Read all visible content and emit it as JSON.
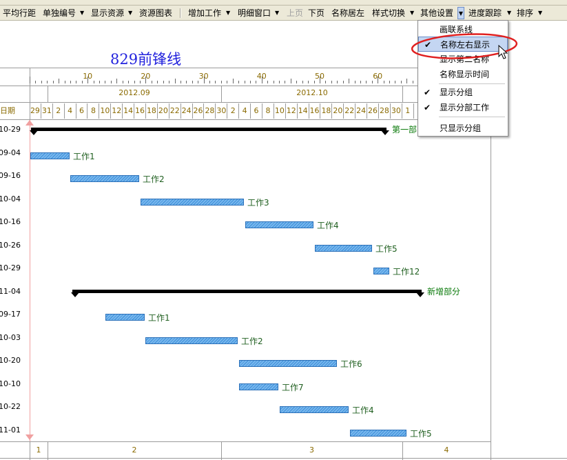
{
  "toolbar": {
    "items": [
      "平均行距",
      "单独编号",
      "显示资源",
      "资源图表",
      "增加工作",
      "明细窗口",
      "上页",
      "下页",
      "名称居左",
      "样式切换",
      "其他设置",
      "进度跟踪",
      "排序"
    ]
  },
  "dropdown": {
    "items": [
      {
        "label": "画联系线",
        "checked": false,
        "highlighted": false
      },
      {
        "label": "名称左右显示",
        "checked": true,
        "highlighted": true
      },
      {
        "label": "显示第二名称",
        "checked": false,
        "highlighted": false
      },
      {
        "label": "名称显示时间",
        "checked": false,
        "highlighted": false
      },
      {
        "label": "显示分组",
        "checked": true,
        "highlighted": false
      },
      {
        "label": "显示分部工作",
        "checked": true,
        "highlighted": false
      },
      {
        "label": "只显示分组",
        "checked": false,
        "highlighted": false
      }
    ]
  },
  "chart": {
    "title": "829前锋线",
    "ruler_labels": [
      "10",
      "20",
      "30",
      "40",
      "50",
      "60"
    ],
    "month_labels": [
      "2012.09",
      "2012.10"
    ],
    "date_header": "日期",
    "days": [
      "29",
      "31",
      "2",
      "4",
      "6",
      "8",
      "10",
      "12",
      "14",
      "16",
      "18",
      "20",
      "22",
      "24",
      "26",
      "28",
      "30",
      "2",
      "4",
      "6",
      "8",
      "10",
      "12",
      "14",
      "16",
      "18",
      "20",
      "22",
      "24",
      "26",
      "28",
      "30",
      "1"
    ],
    "footer_labels": [
      "1",
      "2",
      "3",
      "4"
    ]
  },
  "rows": [
    {
      "date": "10-29",
      "label": "第一部",
      "type": "summary"
    },
    {
      "date": "09-04",
      "label": "工作1",
      "type": "task"
    },
    {
      "date": "09-16",
      "label": "工作2",
      "type": "task"
    },
    {
      "date": "10-04",
      "label": "工作3",
      "type": "task"
    },
    {
      "date": "10-16",
      "label": "工作4",
      "type": "task"
    },
    {
      "date": "10-26",
      "label": "工作5",
      "type": "task"
    },
    {
      "date": "10-29",
      "label": "工作12",
      "type": "task"
    },
    {
      "date": "11-04",
      "label": "新增部分",
      "type": "summary"
    },
    {
      "date": "09-17",
      "label": "工作1",
      "type": "task"
    },
    {
      "date": "10-03",
      "label": "工作2",
      "type": "task"
    },
    {
      "date": "10-20",
      "label": "工作6",
      "type": "task"
    },
    {
      "date": "10-10",
      "label": "工作7",
      "type": "task"
    },
    {
      "date": "10-22",
      "label": "工作4",
      "type": "task"
    },
    {
      "date": "11-01",
      "label": "工作5",
      "type": "task"
    }
  ],
  "colors": {
    "title": "#2222dd",
    "bar": "#3d8fd8",
    "summary": "#000000",
    "highlight_circle": "#e02020"
  }
}
